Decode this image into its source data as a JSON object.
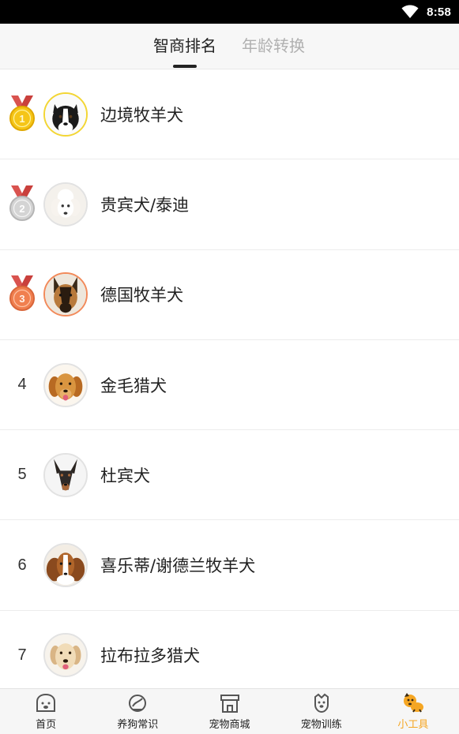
{
  "status_bar": {
    "time": "8:58"
  },
  "tabs": [
    {
      "label": "智商排名",
      "active": true
    },
    {
      "label": "年龄转换",
      "active": false
    }
  ],
  "dogs": [
    {
      "rank": "1",
      "medal": "gold",
      "name": "边境牧羊犬",
      "avatar_icon": "border-collie-photo"
    },
    {
      "rank": "2",
      "medal": "silver",
      "name": "贵宾犬/泰迪",
      "avatar_icon": "poodle-photo"
    },
    {
      "rank": "3",
      "medal": "bronze",
      "name": "德国牧羊犬",
      "avatar_icon": "german-shepherd-photo"
    },
    {
      "rank": "4",
      "medal": null,
      "name": "金毛猎犬",
      "avatar_icon": "golden-retriever-photo"
    },
    {
      "rank": "5",
      "medal": null,
      "name": "杜宾犬",
      "avatar_icon": "doberman-photo"
    },
    {
      "rank": "6",
      "medal": null,
      "name": "喜乐蒂/谢德兰牧羊犬",
      "avatar_icon": "sheltie-photo"
    },
    {
      "rank": "7",
      "medal": null,
      "name": "拉布拉多猎犬",
      "avatar_icon": "labrador-photo"
    }
  ],
  "bottom_nav": [
    {
      "label": "首页",
      "icon": "home-dog-icon",
      "active": false
    },
    {
      "label": "养狗常识",
      "icon": "knowledge-icon",
      "active": false
    },
    {
      "label": "宠物商城",
      "icon": "shop-icon",
      "active": false
    },
    {
      "label": "宠物训练",
      "icon": "training-icon",
      "active": false
    },
    {
      "label": "小工具",
      "icon": "tools-dog-icon",
      "active": true
    }
  ],
  "colors": {
    "accent": "#f5a623",
    "gold": "#f3d634",
    "silver": "#c9c9c9",
    "bronze": "#f28a5a",
    "ribbon": "#d9534f"
  }
}
